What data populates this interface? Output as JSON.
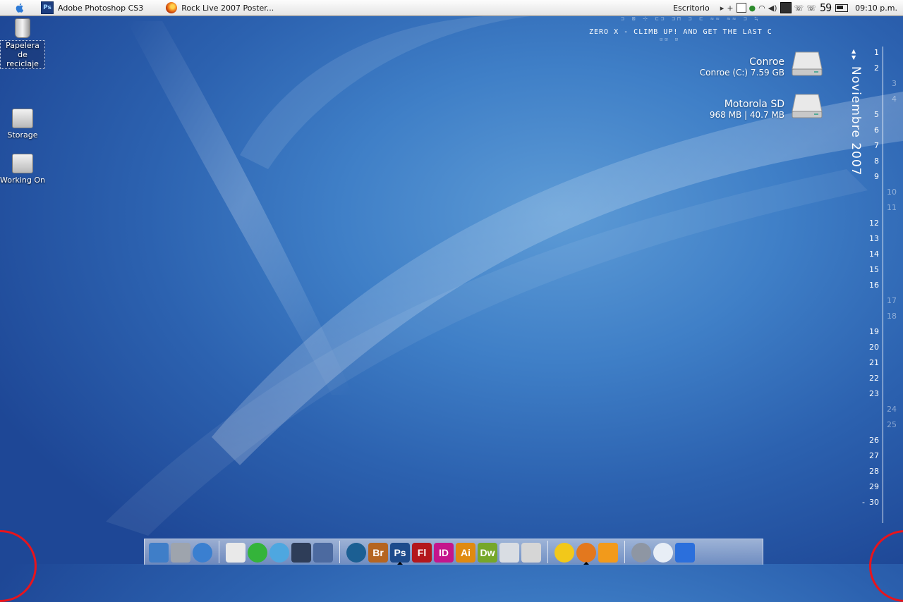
{
  "menubar": {
    "tasks": [
      {
        "label": "Adobe Photoshop CS3",
        "icon": "photoshop-icon"
      },
      {
        "label": "Rock Live 2007 Poster...",
        "icon": "firefox-icon"
      }
    ],
    "location": "Escritorio",
    "tray_number": "59",
    "clock": "09:10 p.m.",
    "tray_icons": [
      "triangle-icon",
      "plus-icon",
      "battery-icon",
      "user-icon",
      "wifi-icon",
      "volume-icon",
      "monitor-icon",
      "phone-icon",
      "phone-icon",
      "battery-icon"
    ]
  },
  "desktop": {
    "icons": [
      {
        "label": "Papelera de reciclaje",
        "icon": "trash-icon",
        "selected": true
      },
      {
        "label": "Storage",
        "icon": "drive-icon"
      },
      {
        "label": "Working On",
        "icon": "drive-icon"
      }
    ]
  },
  "banner": {
    "text": "ZERO X - CLIMB UP! AND GET THE LAST CHANCE",
    "top_glyphs": "⊐ ⊠ ⊹ ⊏⊐ ⊐⊓ ⊐ ⊏ ≈≈ ≈≈ ⊐ ≒",
    "sub_glyphs": "⊡⊡ ⊡"
  },
  "drives": [
    {
      "name": "Conroe",
      "info": "Conroe (C:) 7.59 GB"
    },
    {
      "name": "Motorola SD",
      "info": "968 MB | 40.7 MB"
    }
  ],
  "calendar": {
    "month": "Noviembre 2007",
    "days": [
      "1",
      "2",
      "3",
      "4",
      "5",
      "6",
      "7",
      "8",
      "9",
      "10",
      "11",
      "12",
      "13",
      "14",
      "15",
      "16",
      "17",
      "18",
      "19",
      "20",
      "21",
      "22",
      "23",
      "24",
      "25",
      "26",
      "27",
      "28",
      "29",
      "30"
    ],
    "weekend_days": [
      3,
      4,
      10,
      11,
      17,
      18,
      24,
      25
    ],
    "today": 30
  },
  "dock": {
    "groups": [
      [
        {
          "name": "finder-icon",
          "color": "#3f7ec8"
        },
        {
          "name": "system-preferences-icon",
          "color": "#9ea4ad"
        },
        {
          "name": "globe-icon",
          "color": "#3a7fd0"
        }
      ],
      [
        {
          "name": "text-file-icon",
          "color": "#e9e9e9"
        },
        {
          "name": "download-icon",
          "color": "#34b43a"
        },
        {
          "name": "itunes-icon",
          "color": "#4ea7e0"
        },
        {
          "name": "film-icon",
          "color": "#2e3d58"
        },
        {
          "name": "photo-icon",
          "color": "#4c6aa0"
        }
      ],
      [
        {
          "name": "adobe-app-icon",
          "color": "#1b5f93"
        },
        {
          "name": "bridge-icon",
          "label": "Br",
          "color": "#b56521"
        },
        {
          "name": "photoshop-icon",
          "label": "Ps",
          "color": "#1d4b8c",
          "running": true
        },
        {
          "name": "flash-icon",
          "label": "Fl",
          "color": "#b3171c"
        },
        {
          "name": "indesign-icon",
          "label": "ID",
          "color": "#c4158c"
        },
        {
          "name": "illustrator-icon",
          "label": "Ai",
          "color": "#e08a10"
        },
        {
          "name": "dreamweaver-icon",
          "label": "Dw",
          "color": "#76a72a"
        },
        {
          "name": "horse-icon",
          "color": "#d9dde3"
        },
        {
          "name": "scanner-icon",
          "color": "#d6d6d6"
        }
      ],
      [
        {
          "name": "radiation-icon",
          "color": "#f2c81a"
        },
        {
          "name": "firefox-icon",
          "color": "#e3781e",
          "running": true
        },
        {
          "name": "lightning-icon",
          "color": "#f29a1b"
        }
      ],
      [
        {
          "name": "weather-icon",
          "color": "#8e96a3"
        },
        {
          "name": "wifi-icon",
          "color": "#e8eef6"
        },
        {
          "name": "bluetooth-icon",
          "color": "#2b6fdc"
        }
      ]
    ]
  }
}
